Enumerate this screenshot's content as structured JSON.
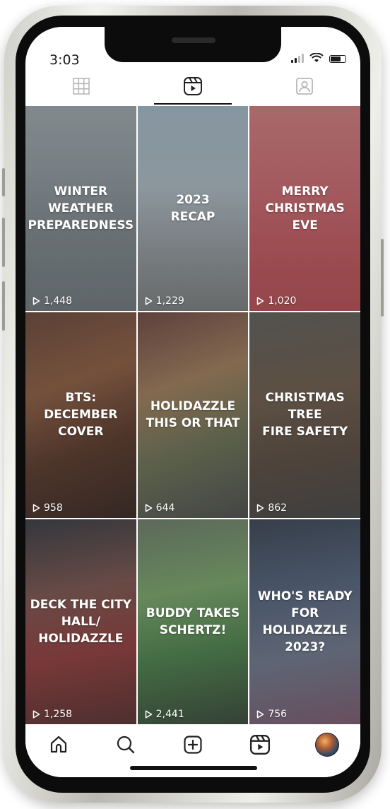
{
  "status_bar": {
    "time": "3:03"
  },
  "tabs": [
    {
      "name": "grid",
      "icon": "grid-icon",
      "active": false
    },
    {
      "name": "reels",
      "icon": "reels-icon",
      "active": true
    },
    {
      "name": "tagged",
      "icon": "tagged-icon",
      "active": false
    }
  ],
  "reels": [
    {
      "title": "WINTER\nWEATHER\nPREPAREDNESS",
      "views": "1,448",
      "bg": "linear-gradient(180deg,#9aa2a6 0%,#8d969b 30%,#7c8489 60%,#6f767a 100%)"
    },
    {
      "title": "2023\nRECAP",
      "views": "1,229",
      "bg": "linear-gradient(180deg,#9fb1be 0%,#a6b2ba 40%,#8f9498 70%,#7a7c7c 100%)"
    },
    {
      "title": "MERRY\nCHRISTMAS\nEVE",
      "views": "1,020",
      "bg": "linear-gradient(180deg,#c97a7d 0%,#c46b70 35%,#b9585e 70%,#b24f55 100%)"
    },
    {
      "title": "BTS: DECEMBER\nCOVER",
      "views": "958",
      "bg": "linear-gradient(160deg,#6a4a3c 0%,#8a5d44 35%,#5a3b2e 65%,#3c2b26 100%)"
    },
    {
      "title": "HOLIDAZZLE\nTHIS OR THAT",
      "views": "644",
      "bg": "linear-gradient(160deg,#6e4a45 0%,#9b7b5c 35%,#6a6f55 65%,#4f4f4f 100%)"
    },
    {
      "title": "CHRISTMAS TREE\nFIRE SAFETY",
      "views": "862",
      "bg": "linear-gradient(170deg,#5f5e5a 0%,#6d5b4c 40%,#5a4c42 70%,#484848 100%)"
    },
    {
      "title": "DECK THE CITY\nHALL/\nHOLIDAZZLE",
      "views": "1,258",
      "bg": "linear-gradient(170deg,#3b3e44 0%,#7a5550 35%,#8e3f3f 65%,#5a3434 100%)"
    },
    {
      "title": "BUDDY TAKES\nSCHERTZ!",
      "views": "2,441",
      "bg": "linear-gradient(170deg,#6d7a6a 0%,#78a06a 35%,#4e7d4c 65%,#3c4a3c 100%)"
    },
    {
      "title": "WHO'S READY\nFOR HOLIDAZZLE\n2023?",
      "views": "756",
      "bg": "linear-gradient(170deg,#3e4754 0%,#556279 35%,#6e7688 65%,#7a5a6e 100%)"
    }
  ],
  "bottom_nav": [
    {
      "name": "home",
      "icon": "home-icon"
    },
    {
      "name": "search",
      "icon": "search-icon"
    },
    {
      "name": "create",
      "icon": "plus-square-icon"
    },
    {
      "name": "reels",
      "icon": "reels-icon"
    },
    {
      "name": "profile",
      "icon": "avatar"
    }
  ]
}
